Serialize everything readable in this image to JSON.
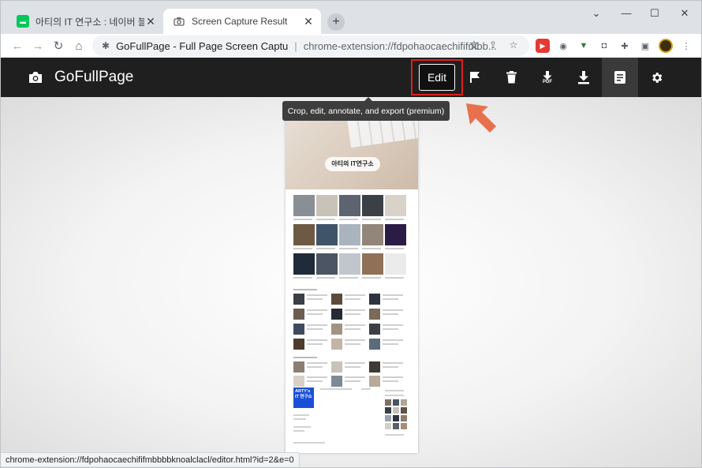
{
  "browser": {
    "tabs": [
      {
        "title": "아티의 IT 연구소 : 네이버 블로그",
        "favicon": "naver-icon",
        "active": false
      },
      {
        "title": "Screen Capture Result",
        "favicon": "camera-icon",
        "active": true
      }
    ],
    "new_tab_label": "+",
    "window_controls": {
      "tab_search": "⌄",
      "minimize": "—",
      "maximize": "☐",
      "close": "✕"
    },
    "omnibox": {
      "page_title": "GoFullPage - Full Page Screen Captu",
      "url": "chrome-extension://fdpohaocaechififmbb..."
    }
  },
  "app": {
    "name": "GoFullPage",
    "toolbar": {
      "edit_label": "Edit",
      "pdf_label": "PDF"
    },
    "tooltip": "Crop, edit, annotate, and export (premium)"
  },
  "preview": {
    "hero_title": "아티의 IT연구소",
    "brand_box": "ARTY's IT 연구소"
  },
  "status_bar": "chrome-extension://fdpohaocaechififmbbbbknoalclacl/editor.html?id=2&e=0",
  "colors": {
    "header_bg": "#1f1f1f",
    "highlight": "#e0201c",
    "arrow": "#e8704d"
  }
}
